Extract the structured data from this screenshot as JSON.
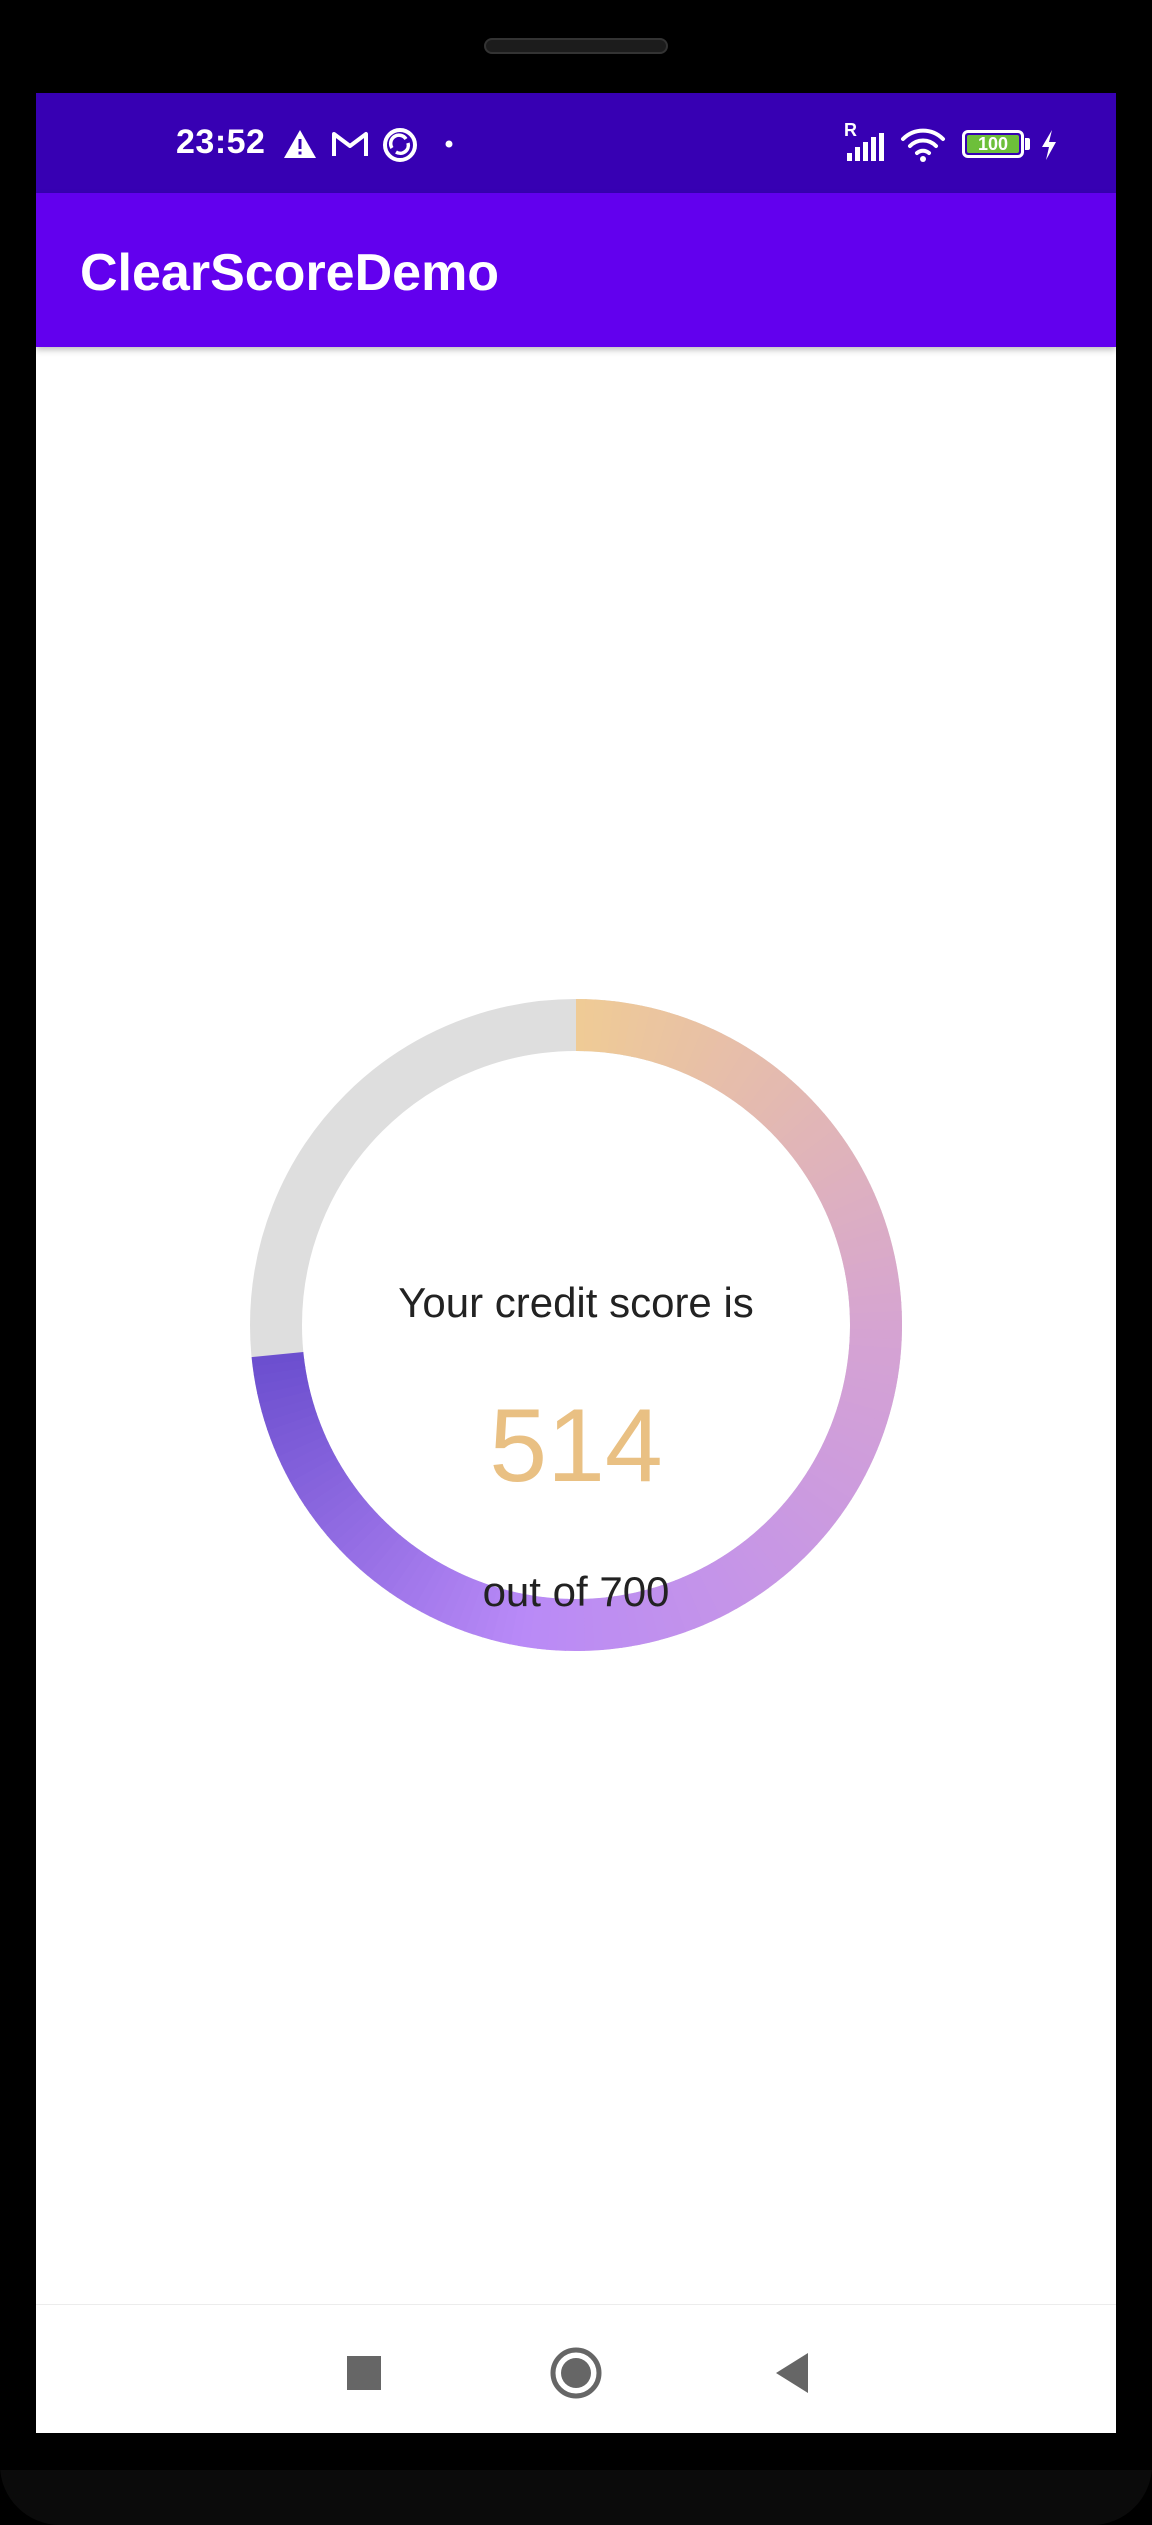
{
  "status_bar": {
    "time": "23:52",
    "icons": [
      "warning-icon",
      "gmail-icon",
      "sync-icon",
      "dot-icon",
      "signal-icon",
      "wifi-icon",
      "battery-icon",
      "charging-icon"
    ],
    "signal_badge": "R",
    "battery_level": "100"
  },
  "app_bar": {
    "title": "ClearScoreDemo"
  },
  "score": {
    "label_top": "Your credit score is",
    "value": "514",
    "label_bottom": "out of 700",
    "score_number": 514,
    "max_score": 700,
    "colors": {
      "track": "#dedede",
      "gradient_start": "#efcb96",
      "gradient_mid": "#d5a3d3",
      "gradient_purple": "#b98af7",
      "gradient_end": "#6c4fcf",
      "score_text": "#e9c083"
    }
  },
  "nav_bar": {
    "buttons": [
      "recents-button",
      "home-button",
      "back-button"
    ]
  },
  "colors": {
    "status_bar": "#3700b3",
    "app_bar": "#6200ee"
  }
}
